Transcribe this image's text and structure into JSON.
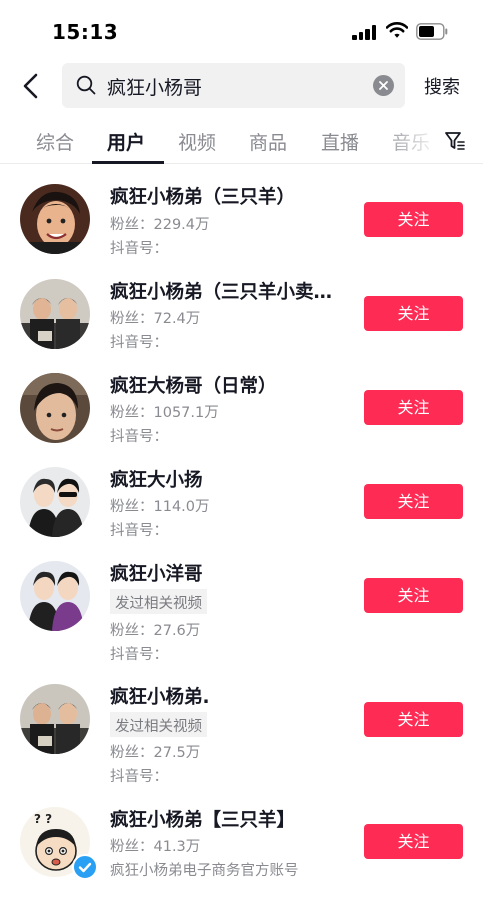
{
  "status_bar": {
    "time": "15:13"
  },
  "search": {
    "query": "疯狂小杨哥",
    "button_label": "搜索"
  },
  "tabs": [
    {
      "label": "综合"
    },
    {
      "label": "用户"
    },
    {
      "label": "视频"
    },
    {
      "label": "商品"
    },
    {
      "label": "直播"
    },
    {
      "label": "音乐"
    }
  ],
  "users": [
    {
      "name": "疯狂小杨弟（三只羊）",
      "fans": "粉丝：229.4万",
      "douyin_id": "抖音号：",
      "follow_label": "关注"
    },
    {
      "name": "疯狂小杨弟（三只羊小卖…",
      "fans": "粉丝：72.4万",
      "douyin_id": "抖音号：",
      "follow_label": "关注"
    },
    {
      "name": "疯狂大杨哥（日常）",
      "fans": "粉丝：1057.1万",
      "douyin_id": "抖音号：",
      "follow_label": "关注"
    },
    {
      "name": "疯狂大小扬",
      "fans": "粉丝：114.0万",
      "douyin_id": "抖音号：",
      "follow_label": "关注"
    },
    {
      "name": "疯狂小洋哥",
      "tag": "发过相关视频",
      "fans": "粉丝：27.6万",
      "douyin_id": "抖音号：",
      "follow_label": "关注"
    },
    {
      "name": "疯狂小杨弟.",
      "tag": "发过相关视频",
      "fans": "粉丝：27.5万",
      "douyin_id": "抖音号：",
      "follow_label": "关注"
    },
    {
      "name": "疯狂小杨弟【三只羊】",
      "fans": "粉丝：41.3万",
      "description": "疯狂小杨弟电子商务官方账号",
      "follow_label": "关注",
      "verified": true
    }
  ],
  "colors": {
    "accent": "#fe2c55",
    "verified": "#2aa0f4",
    "secondary_text": "#8a8b91"
  }
}
